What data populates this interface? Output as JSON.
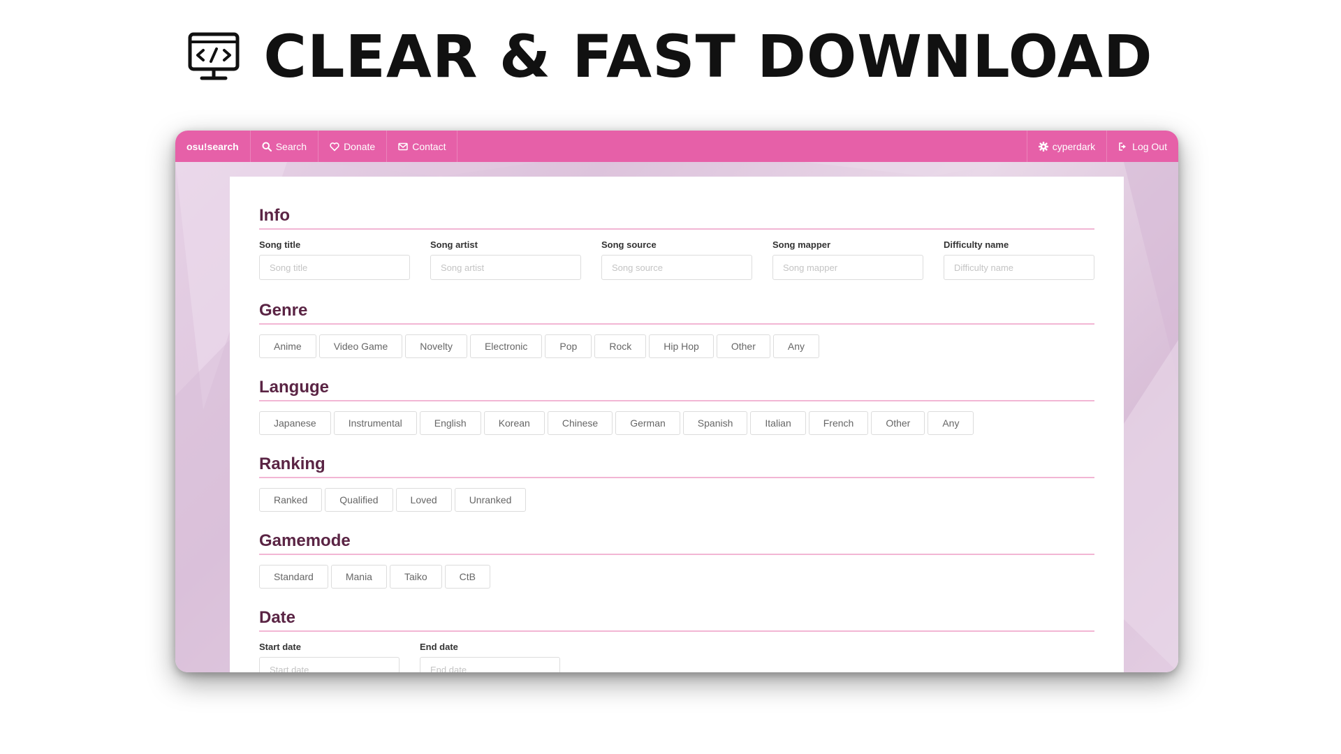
{
  "headline": {
    "icon": "monitor-code-icon",
    "text": "CLEAR & FAST DOWNLOAD"
  },
  "navbar": {
    "brand": "osu!search",
    "left_items": [
      {
        "label": "Search",
        "icon": "search-icon"
      },
      {
        "label": "Donate",
        "icon": "heart-icon"
      },
      {
        "label": "Contact",
        "icon": "envelope-icon"
      }
    ],
    "right_items": [
      {
        "label": "cyperdark",
        "icon": "gear-icon"
      },
      {
        "label": "Log Out",
        "icon": "logout-icon"
      }
    ],
    "color": "#e660a8"
  },
  "sections": {
    "info": {
      "title": "Info",
      "fields": [
        {
          "label": "Song title",
          "placeholder": "Song title"
        },
        {
          "label": "Song artist",
          "placeholder": "Song artist"
        },
        {
          "label": "Song source",
          "placeholder": "Song source"
        },
        {
          "label": "Song mapper",
          "placeholder": "Song mapper"
        },
        {
          "label": "Difficulty name",
          "placeholder": "Difficulty name"
        }
      ]
    },
    "genre": {
      "title": "Genre",
      "options": [
        "Anime",
        "Video Game",
        "Novelty",
        "Electronic",
        "Pop",
        "Rock",
        "Hip Hop",
        "Other",
        "Any"
      ]
    },
    "language": {
      "title": "Languge",
      "options": [
        "Japanese",
        "Instrumental",
        "English",
        "Korean",
        "Chinese",
        "German",
        "Spanish",
        "Italian",
        "French",
        "Other",
        "Any"
      ]
    },
    "ranking": {
      "title": "Ranking",
      "options": [
        "Ranked",
        "Qualified",
        "Loved",
        "Unranked"
      ]
    },
    "gamemode": {
      "title": "Gamemode",
      "options": [
        "Standard",
        "Mania",
        "Taiko",
        "CtB"
      ]
    },
    "date": {
      "title": "Date",
      "fields": [
        {
          "label": "Start date",
          "placeholder": "Start date"
        },
        {
          "label": "End date",
          "placeholder": "End date"
        }
      ]
    }
  },
  "colors": {
    "accent": "#e660a8",
    "section_title": "#5a2444",
    "section_rule": "#f2b6d4"
  }
}
